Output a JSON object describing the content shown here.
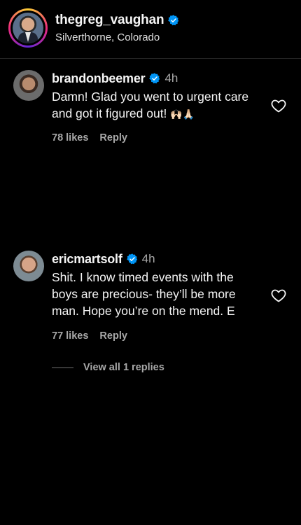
{
  "header": {
    "username": "thegreg_vaughan",
    "location": "Silverthorne, Colorado",
    "avatar_icon": "profile-avatar",
    "verified_icon": "verified-badge-icon"
  },
  "comments": [
    {
      "username": "brandonbeemer",
      "time": "4h",
      "text": "Damn! Glad you went to urgent care and got it figured out!",
      "emoji": "🙌🏻🙏🏻",
      "likes": "78 likes",
      "reply": "Reply"
    },
    {
      "username": "ericmartsolf",
      "time": "4h",
      "text": "Shit. I know timed events with the boys are precious- they’ll be more man. Hope you’re on the mend. E",
      "likes": "77 likes",
      "reply": "Reply",
      "view_replies": "View all 1 replies"
    }
  ],
  "colors": {
    "background": "#000000",
    "verified": "#0095f6",
    "secondary_text": "#a8a8a8"
  }
}
